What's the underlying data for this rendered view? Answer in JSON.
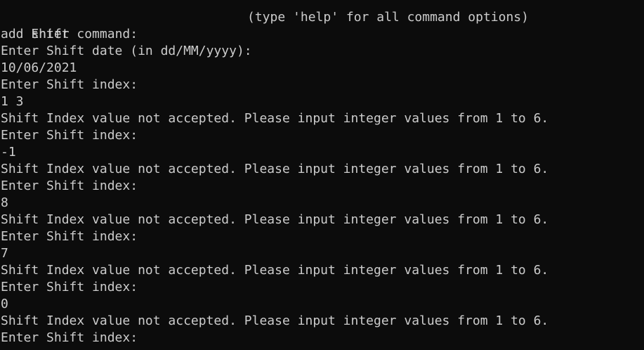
{
  "terminal": {
    "prompt_line": {
      "text": "Enter command:",
      "hint": "(type 'help' for all command options)"
    },
    "lines": [
      "add shift",
      "Enter Shift date (in dd/MM/yyyy):",
      "10/06/2021",
      "Enter Shift index:",
      "1 3",
      "Shift Index value not accepted. Please input integer values from 1 to 6.",
      "Enter Shift index:",
      "-1",
      "Shift Index value not accepted. Please input integer values from 1 to 6.",
      "Enter Shift index:",
      "8",
      "Shift Index value not accepted. Please input integer values from 1 to 6.",
      "Enter Shift index:",
      "7",
      "Shift Index value not accepted. Please input integer values from 1 to 6.",
      "Enter Shift index:",
      "0",
      "Shift Index value not accepted. Please input integer values from 1 to 6.",
      "Enter Shift index:"
    ],
    "colors": {
      "background": "#0c0c0c",
      "foreground": "#cccccc"
    }
  }
}
